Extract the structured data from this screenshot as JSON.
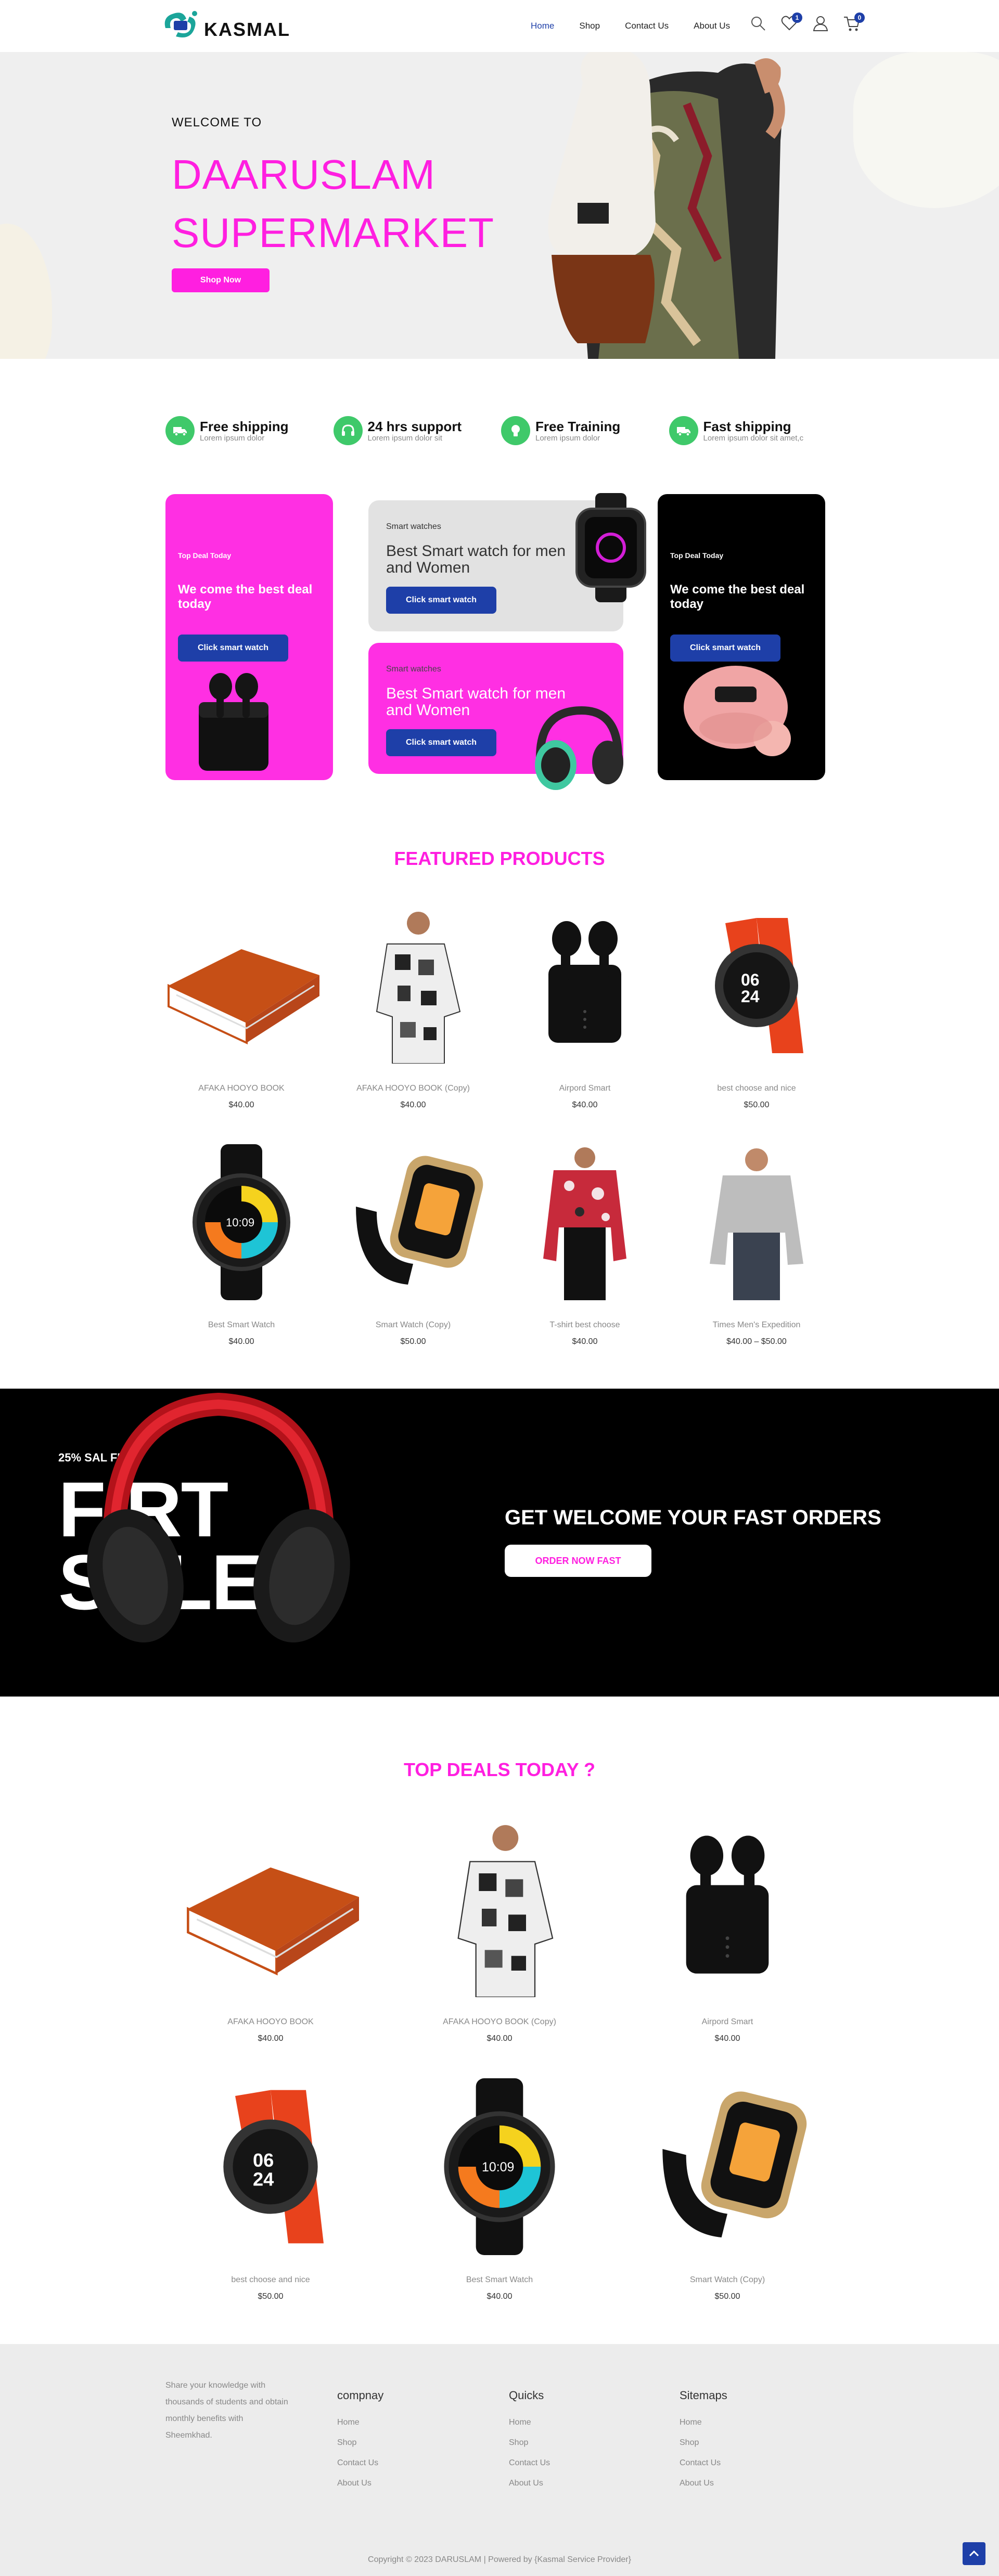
{
  "header": {
    "logo_text": "KASMAL",
    "nav": [
      "Home",
      "Shop",
      "Contact Us",
      "About Us"
    ],
    "wishlist_count": "1",
    "cart_count": "0"
  },
  "hero": {
    "welcome": "WELCOME TO",
    "title_line1": "DAARUSLAM",
    "title_line2": "SUPERMARKET",
    "button": "Shop Now"
  },
  "features": [
    {
      "title": "Free shipping",
      "sub": "Lorem ipsum dolor",
      "icon": "truck-icon"
    },
    {
      "title": "24 hrs support",
      "sub": "Lorem ipsum dolor sit",
      "icon": "headset-icon"
    },
    {
      "title": "Free Training",
      "sub": "Lorem ipsum dolor",
      "icon": "bulb-icon"
    },
    {
      "title": "Fast shipping",
      "sub": "Lorem ipsum dolor sit amet,c",
      "icon": "truck-icon"
    }
  ],
  "promos": {
    "card1": {
      "label": "Top Deal Today",
      "headline": "We come the best deal today",
      "button": "Click smart watch"
    },
    "card2": {
      "label": "Smart watches",
      "headline": "Best Smart watch for men and Women",
      "button": "Click smart watch"
    },
    "card3": {
      "label": "Smart watches",
      "headline": "Best Smart watch for men and Women",
      "button": "Click smart watch"
    },
    "card4": {
      "label": "Top Deal Today",
      "headline": "We come the best deal today",
      "button": "Click smart watch"
    }
  },
  "featured": {
    "title": "FEATURED PRODUCTS",
    "products": [
      {
        "name": "AFAKA HOOYO BOOK",
        "price": "$40.00",
        "kind": "book"
      },
      {
        "name": "AFAKA HOOYO BOOK (Copy)",
        "price": "$40.00",
        "kind": "shirt"
      },
      {
        "name": "Airpord Smart",
        "price": "$40.00",
        "kind": "airpods"
      },
      {
        "name": "best choose and nice",
        "price": "$50.00",
        "kind": "watch-orange"
      },
      {
        "name": "Best Smart Watch",
        "price": "$40.00",
        "kind": "watch-round"
      },
      {
        "name": "Smart Watch (Copy)",
        "price": "$50.00",
        "kind": "watch-square"
      },
      {
        "name": "T-shirt best choose",
        "price": "$40.00",
        "kind": "floral"
      },
      {
        "name": "Times Men's Expedition",
        "price": "$40.00 – $50.00",
        "kind": "sweater"
      }
    ]
  },
  "sale": {
    "small": "25% SAL FL",
    "big_line1": "FIRT",
    "big_line2": "SALE",
    "headline": "GET WELCOME YOUR FAST ORDERS",
    "button": "ORDER NOW FAST"
  },
  "deals": {
    "title": "TOP DEALS TODAY ?",
    "products": [
      {
        "name": "AFAKA HOOYO BOOK",
        "price": "$40.00",
        "kind": "book"
      },
      {
        "name": "AFAKA HOOYO BOOK (Copy)",
        "price": "$40.00",
        "kind": "shirt"
      },
      {
        "name": "Airpord Smart",
        "price": "$40.00",
        "kind": "airpods"
      },
      {
        "name": "best choose and nice",
        "price": "$50.00",
        "kind": "watch-orange"
      },
      {
        "name": "Best Smart Watch",
        "price": "$40.00",
        "kind": "watch-round"
      },
      {
        "name": "Smart Watch (Copy)",
        "price": "$50.00",
        "kind": "watch-square"
      }
    ]
  },
  "footer": {
    "about": "Share your knowledge with thousands of students and obtain monthly benefits with Sheemkhad.",
    "cols": [
      {
        "title": "compnay",
        "links": [
          "Home",
          "Shop",
          "Contact Us",
          "About Us"
        ]
      },
      {
        "title": "Quicks",
        "links": [
          "Home",
          "Shop",
          "Contact Us",
          "About Us"
        ]
      },
      {
        "title": "Sitemaps",
        "links": [
          "Home",
          "Shop",
          "Contact Us",
          "About Us"
        ]
      }
    ],
    "copyright": "Copyright © 2023 DARUSLAM | Powered by {Kasmal Service Provider}"
  },
  "colors": {
    "accent": "#ff1fe0",
    "brand_blue": "#1e3fa8",
    "feature_green": "#3fc96a"
  }
}
